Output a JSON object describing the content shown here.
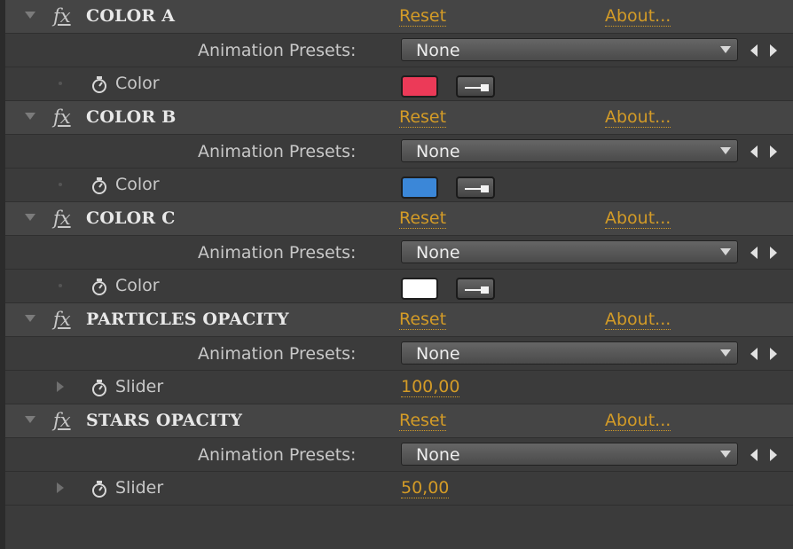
{
  "effects": [
    {
      "name": "COLOR A",
      "reset_label": "Reset",
      "about_label": "About...",
      "preset_label": "Animation Presets:",
      "preset_value": "None",
      "property": {
        "label": "Color",
        "type": "color",
        "color": "#ec3a58"
      }
    },
    {
      "name": "COLOR B",
      "reset_label": "Reset",
      "about_label": "About...",
      "preset_label": "Animation Presets:",
      "preset_value": "None",
      "property": {
        "label": "Color",
        "type": "color",
        "color": "#3b87d8"
      }
    },
    {
      "name": "COLOR C",
      "reset_label": "Reset",
      "about_label": "About...",
      "preset_label": "Animation Presets:",
      "preset_value": "None",
      "property": {
        "label": "Color",
        "type": "color",
        "color": "#ffffff"
      }
    },
    {
      "name": "PARTICLES OPACITY",
      "reset_label": "Reset",
      "about_label": "About...",
      "preset_label": "Animation Presets:",
      "preset_value": "None",
      "property": {
        "label": "Slider",
        "type": "slider",
        "value": "100,00"
      }
    },
    {
      "name": "STARS OPACITY",
      "reset_label": "Reset",
      "about_label": "About...",
      "preset_label": "Animation Presets:",
      "preset_value": "None",
      "property": {
        "label": "Slider",
        "type": "slider",
        "value": "50,00"
      }
    }
  ],
  "icons": {
    "fx": "fx",
    "stopwatch": "stopwatch-icon",
    "eyedropper": "eyedropper-icon",
    "twirl_open": "triangle-down-icon",
    "twirl_closed": "triangle-right-icon",
    "prev": "left-arrow-icon",
    "next": "right-arrow-icon"
  },
  "colors": {
    "link": "#d39b27",
    "panel_bg": "#3b3b3b"
  }
}
